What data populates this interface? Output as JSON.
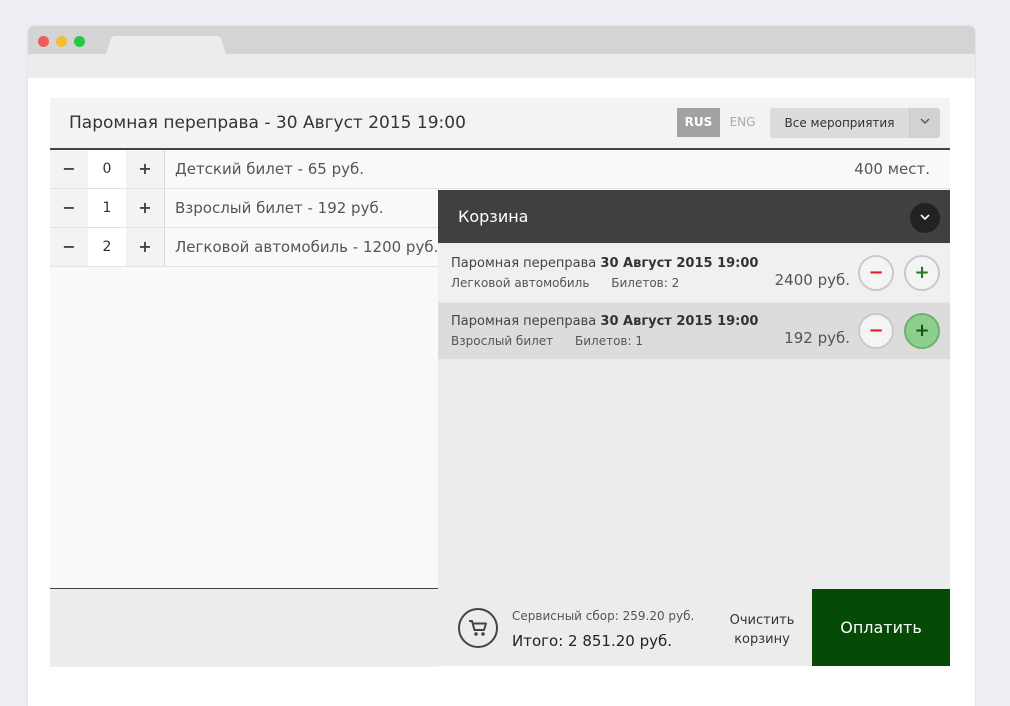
{
  "window": {
    "controls": [
      "close-dot",
      "minimize-dot",
      "maximize-dot"
    ]
  },
  "header": {
    "title": "Паромная переправа - 30 Август 2015 19:00",
    "languages": {
      "rus": "RUS",
      "eng": "ENG"
    },
    "events_select": {
      "value": "Все мероприятия",
      "arrow": "⌄"
    }
  },
  "tickets": [
    {
      "minus": "−",
      "qty": "0",
      "plus": "+",
      "label": "Детский билет - 65 руб.",
      "seats": "400 мест."
    },
    {
      "minus": "−",
      "qty": "1",
      "plus": "+",
      "label": "Взрослый билет - 192 руб."
    },
    {
      "minus": "−",
      "qty": "2",
      "plus": "+",
      "label": "Легковой автомобиль - 1200 руб."
    }
  ],
  "cart": {
    "title": "Корзина",
    "collapse_icon": "⌄",
    "items": [
      {
        "event": "Паромная переправа",
        "date": "30 Август 2015 19:00",
        "ticket": "Легковой автомобиль",
        "count": "Билетов: 2",
        "price": "2400 руб.",
        "minus": "−",
        "plus": "+"
      },
      {
        "event": "Паромная переправа",
        "date": "30 Август 2015 19:00",
        "ticket": "Взрослый билет",
        "count": "Билетов: 1",
        "price": "192 руб.",
        "minus": "−",
        "plus": "+"
      }
    ],
    "fee": "Сервисный сбор: 259.20 руб.",
    "total": "Итого: 2 851.20 руб.",
    "clear_label": "Очистить корзину",
    "pay_label": "Оплатить",
    "cart_icon": "shopping-cart-icon"
  },
  "colors": {
    "pay_button": "#064b05",
    "cart_header": "#404040",
    "minus_icon": "#e0192d",
    "plus_icon": "#1e7a1e",
    "active_plus": "#8fce8f"
  }
}
